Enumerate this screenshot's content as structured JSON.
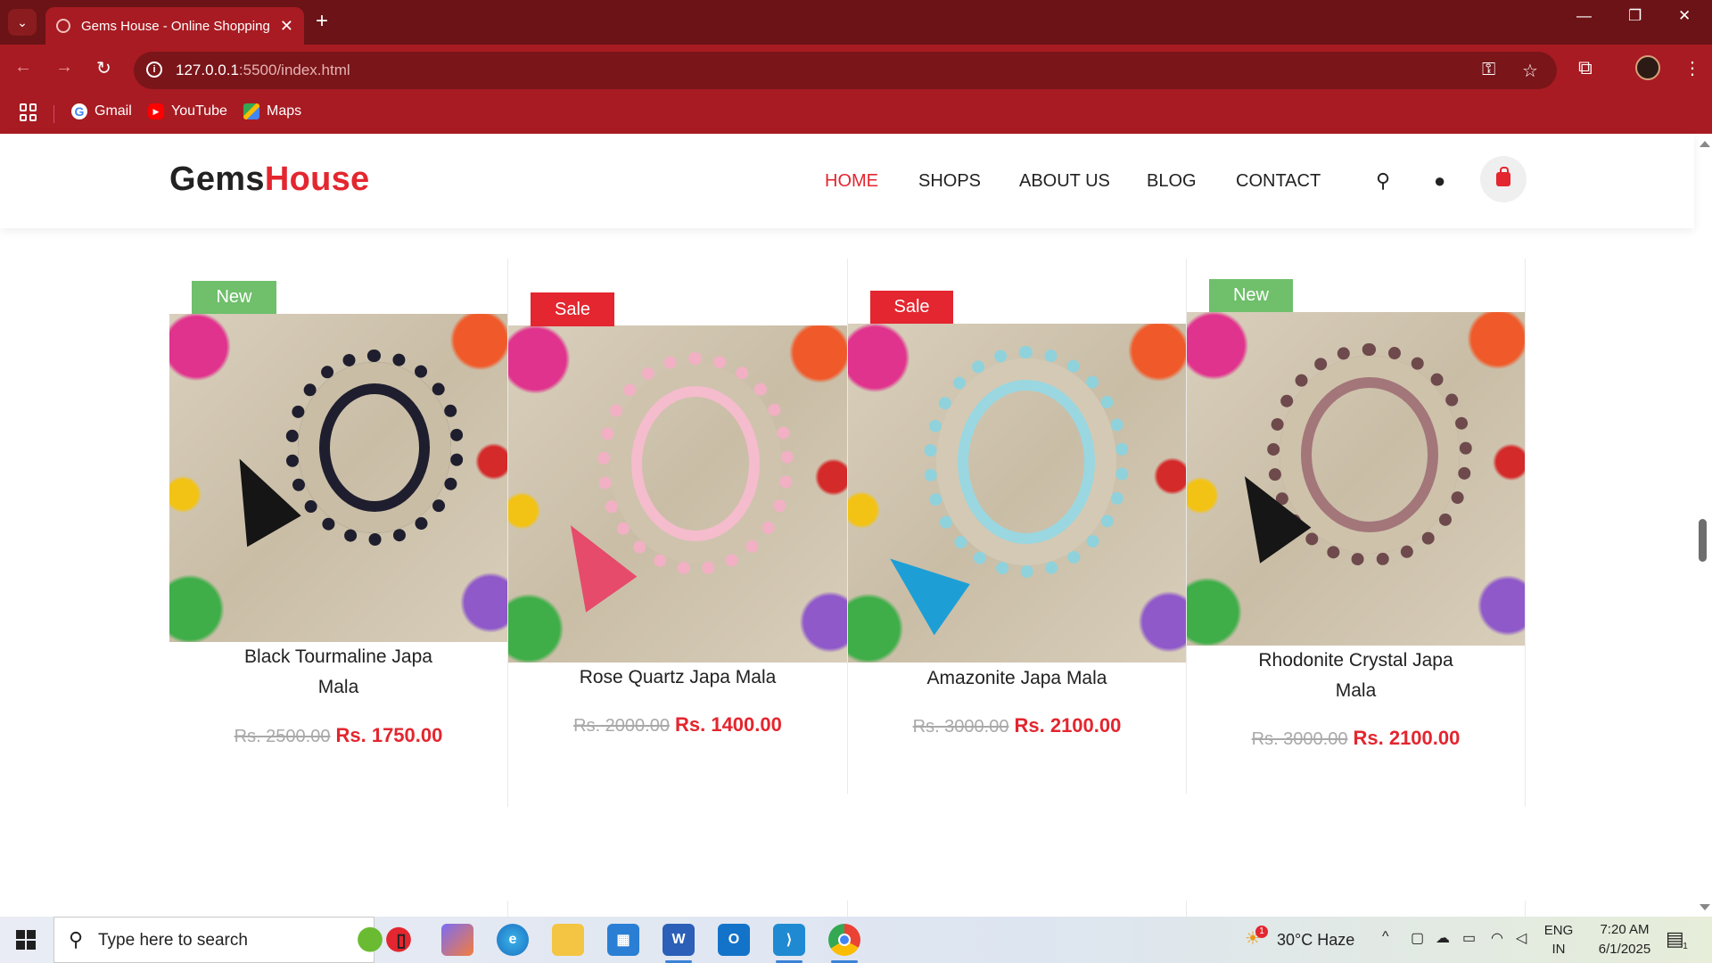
{
  "browser": {
    "tab_title": "Gems House - Online Shopping",
    "url_host": "127.0.0.1",
    "url_rest": ":5500/index.html",
    "bookmarks": [
      {
        "label": "Gmail",
        "icon": "gmail-icon"
      },
      {
        "label": "YouTube",
        "icon": "youtube-icon"
      },
      {
        "label": "Maps",
        "icon": "maps-icon"
      }
    ]
  },
  "site": {
    "logo_main": "Gems",
    "logo_accent": "House",
    "accent_color": "#e3262f",
    "nav": [
      "HOME",
      "SHOPS",
      "ABOUT US",
      "BLOG",
      "CONTACT"
    ],
    "active_nav": "HOME"
  },
  "products": [
    {
      "badge": "New",
      "name_line1": "Black Tourmaline Japa",
      "name_line2": "Mala",
      "old_price": "Rs. 2500.00",
      "price": "Rs. 1750.00"
    },
    {
      "badge": "Sale",
      "name_line1": "Rose Quartz Japa Mala",
      "name_line2": "",
      "old_price": "Rs. 2000.00",
      "price": "Rs. 1400.00"
    },
    {
      "badge": "Sale",
      "name_line1": "Amazonite Japa Mala",
      "name_line2": "",
      "old_price": "Rs. 3000.00",
      "price": "Rs. 2100.00"
    },
    {
      "badge": "New",
      "name_line1": "Rhodonite Crystal Japa",
      "name_line2": "Mala",
      "old_price": "Rs. 3000.00",
      "price": "Rs. 2100.00"
    }
  ],
  "taskbar": {
    "search_placeholder": "Type here to search",
    "weather": "30°C  Haze",
    "weather_alert": "1",
    "lang_top": "ENG",
    "lang_bottom": "IN",
    "time": "7:20 AM",
    "date": "6/1/2025",
    "notifications": "1"
  }
}
